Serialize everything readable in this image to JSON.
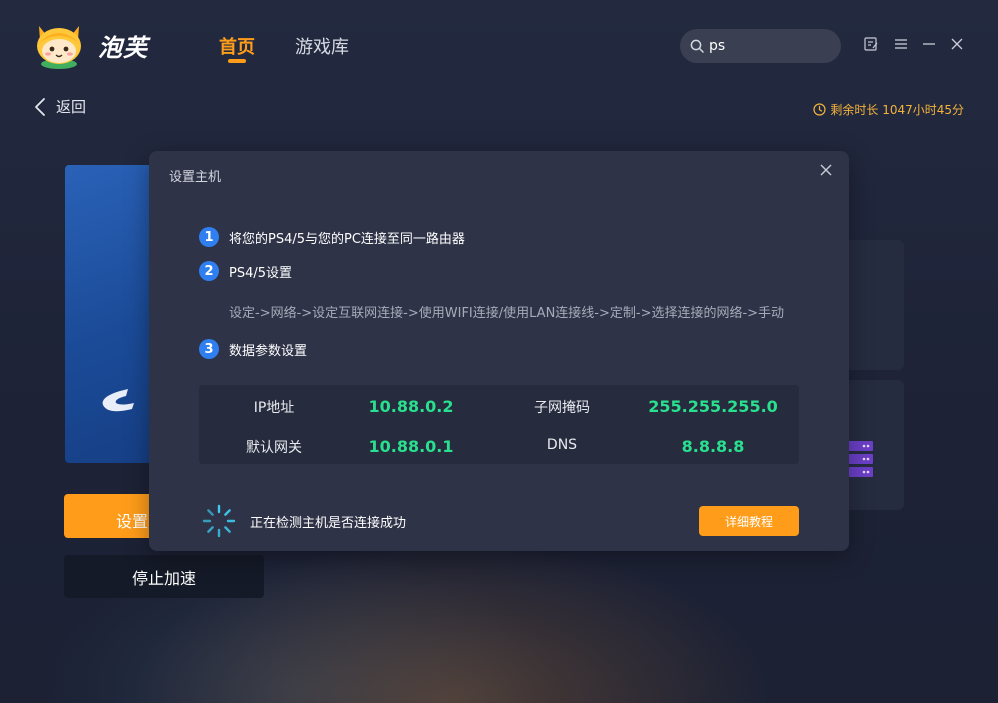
{
  "header": {
    "brand": "泡芙",
    "tabs": [
      {
        "label": "首页",
        "active": true
      },
      {
        "label": "游戏库",
        "active": false
      }
    ],
    "search": {
      "value": "ps"
    },
    "window_controls": [
      "feedback-icon",
      "menu-icon",
      "minimize-icon",
      "close-icon"
    ]
  },
  "back_label": "返回",
  "remaining_time": "剩余时长 1047小时45分",
  "buttons": {
    "setup": "设置",
    "stop": "停止加速"
  },
  "modal": {
    "title": "设置主机",
    "steps": [
      {
        "num": "1",
        "text": "将您的PS4/5与您的PC连接至同一路由器"
      },
      {
        "num": "2",
        "text": "PS4/5设置"
      },
      {
        "num": "3",
        "text": "数据参数设置"
      }
    ],
    "path": "设定->网络->设定互联网连接->使用WIFI连接/使用LAN连接线->定制->选择连接的网络->手动",
    "params": {
      "ip_label": "IP地址",
      "ip_value": "10.88.0.2",
      "subnet_label": "子网掩码",
      "subnet_value": "255.255.255.0",
      "gateway_label": "默认网关",
      "gateway_value": "10.88.0.1",
      "dns_label": "DNS",
      "dns_value": "8.8.8.8"
    },
    "detecting_text": "正在检测主机是否连接成功",
    "tutorial_button": "详细教程"
  },
  "colors": {
    "accent": "#ff9d1a",
    "value_green": "#29e08f",
    "step_blue": "#2f7ff0",
    "modal_bg": "#2e3347"
  }
}
